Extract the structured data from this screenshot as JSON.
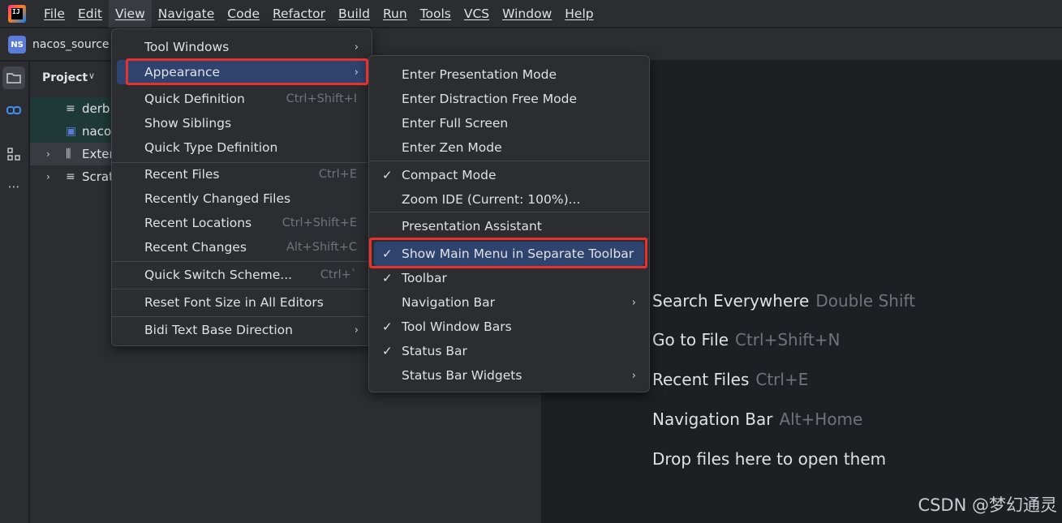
{
  "menubar": {
    "logo_text": "IJ",
    "items": [
      "File",
      "Edit",
      "View",
      "Navigate",
      "Code",
      "Refactor",
      "Build",
      "Run",
      "Tools",
      "VCS",
      "Window",
      "Help"
    ]
  },
  "project": {
    "badge": "NS",
    "name": "nacos_source"
  },
  "panel": {
    "title": "Project",
    "tree": [
      "derb",
      "naco",
      "Exter",
      "Scrat"
    ]
  },
  "view_menu": {
    "items": [
      {
        "label": "Tool Windows",
        "shortcut": ""
      },
      {
        "label": "Appearance",
        "shortcut": ""
      },
      {
        "label": "Quick Definition",
        "shortcut": "Ctrl+Shift+I"
      },
      {
        "label": "Show Siblings",
        "shortcut": ""
      },
      {
        "label": "Quick Type Definition",
        "shortcut": ""
      },
      {
        "label": "Recent Files",
        "shortcut": "Ctrl+E"
      },
      {
        "label": "Recently Changed Files",
        "shortcut": ""
      },
      {
        "label": "Recent Locations",
        "shortcut": "Ctrl+Shift+E"
      },
      {
        "label": "Recent Changes",
        "shortcut": "Alt+Shift+C"
      },
      {
        "label": "Quick Switch Scheme...",
        "shortcut": "Ctrl+`"
      },
      {
        "label": "Reset Font Size in All Editors",
        "shortcut": ""
      },
      {
        "label": "Bidi Text Base Direction",
        "shortcut": ""
      }
    ]
  },
  "appearance_menu": {
    "items": [
      {
        "label": "Enter Presentation Mode"
      },
      {
        "label": "Enter Distraction Free Mode"
      },
      {
        "label": "Enter Full Screen"
      },
      {
        "label": "Enter Zen Mode"
      },
      {
        "label": "Compact Mode"
      },
      {
        "label": "Zoom IDE (Current: 100%)..."
      },
      {
        "label": "Presentation Assistant"
      },
      {
        "label": "Show Main Menu in Separate Toolbar"
      },
      {
        "label": "Toolbar"
      },
      {
        "label": "Navigation Bar"
      },
      {
        "label": "Tool Window Bars"
      },
      {
        "label": "Status Bar"
      },
      {
        "label": "Status Bar Widgets"
      }
    ]
  },
  "editor_hints": [
    {
      "label": "Search Everywhere",
      "shortcut": "Double Shift"
    },
    {
      "label": "Go to File",
      "shortcut": "Ctrl+Shift+N"
    },
    {
      "label": "Recent Files",
      "shortcut": "Ctrl+E"
    },
    {
      "label": "Navigation Bar",
      "shortcut": "Alt+Home"
    },
    {
      "label": "Drop files here to open them",
      "shortcut": ""
    }
  ],
  "watermark": "CSDN @梦幻通灵",
  "colors": {
    "menu_selection": "#2e436e",
    "highlight_box": "#e8302d",
    "background": "#1e1f22",
    "panel": "#2b2d30"
  }
}
